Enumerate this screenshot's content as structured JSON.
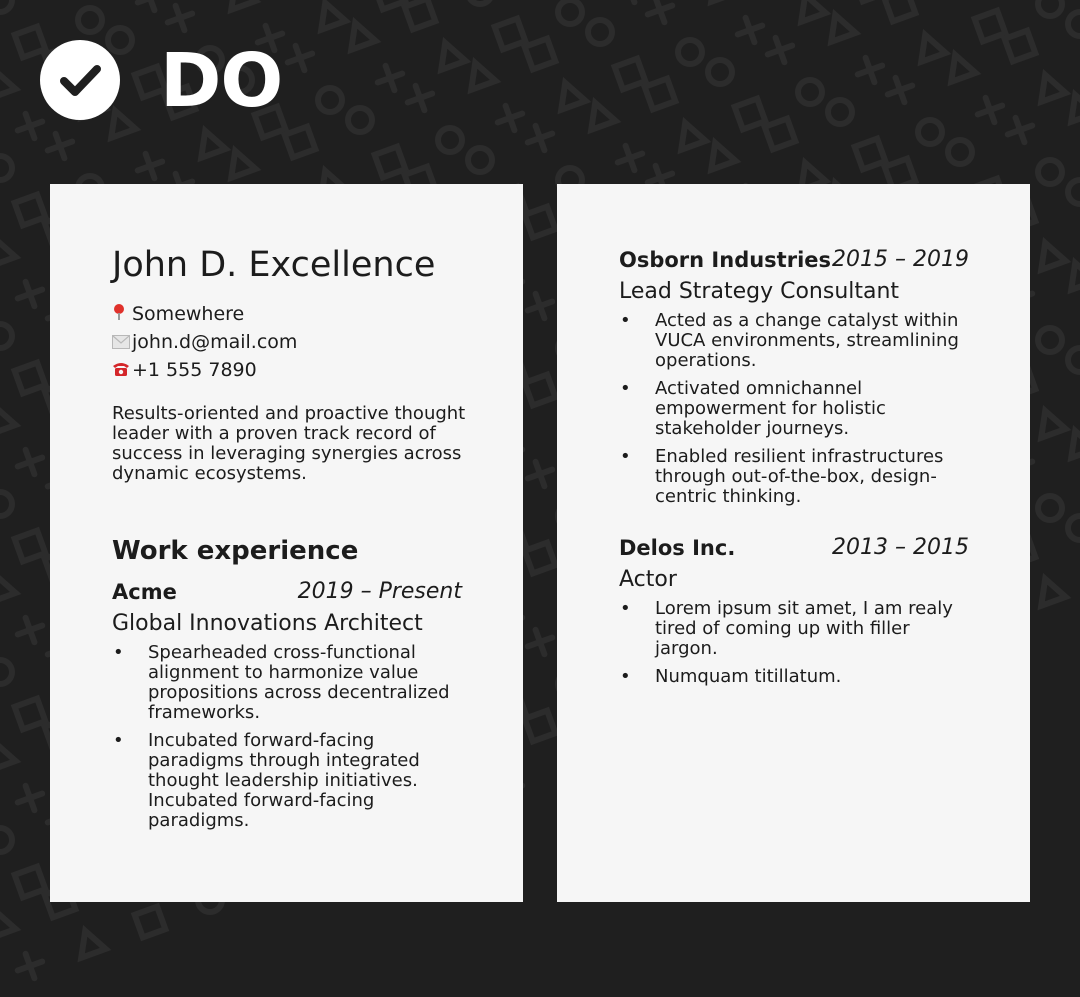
{
  "header": {
    "badge_icon": "checkmark-icon",
    "title": "DO"
  },
  "resume": {
    "name": "John D. Excellence",
    "contact": {
      "location": {
        "icon": "pin-icon",
        "text": "Somewhere"
      },
      "email": {
        "icon": "envelope-icon",
        "text": "john.d@mail.com"
      },
      "phone": {
        "icon": "telephone-icon",
        "text": "+1 555 7890"
      }
    },
    "summary": "Results-oriented and proactive thought leader with a proven track record of success in leveraging synergies across dynamic ecosystems.",
    "section_title": "Work experience",
    "jobs": [
      {
        "company": "Acme",
        "dates": "2019 – Present",
        "role": "Global Innovations Architect",
        "bullets": [
          "Spearheaded cross-functional alignment to harmonize value propositions across decentralized frameworks.",
          "Incubated forward-facing paradigms through integrated thought leadership initiatives. Incubated forward-facing paradigms."
        ]
      },
      {
        "company": "Osborn Industries",
        "dates": "2015 – 2019",
        "role": "Lead Strategy Consultant",
        "bullets": [
          "Acted as a change catalyst within VUCA environments, streamlining operations.",
          "Activated omnichannel empowerment for holistic stakeholder journeys.",
          "Enabled resilient infrastructures through out-of-the-box, design-centric thinking."
        ]
      },
      {
        "company": "Delos Inc.",
        "dates": "2013 – 2015",
        "role": "Actor",
        "bullets": [
          "Lorem ipsum sit amet, I am realy tired of coming up with filler jargon.",
          "Numquam titillatum."
        ]
      }
    ]
  },
  "colors": {
    "background": "#1f1f1f",
    "pattern": "#2c2c2c",
    "page": "#f6f6f6",
    "text": "#1c1c1c",
    "badge": "#ffffff"
  }
}
